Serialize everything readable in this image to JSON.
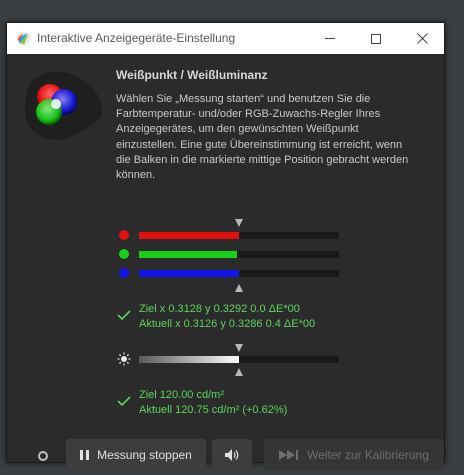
{
  "window": {
    "title": "Interaktive Anzeigegeräte-Einstellung"
  },
  "panel": {
    "heading": "Weißpunkt / Weißluminanz",
    "instructions": "Wählen Sie „Messung starten“ und benutzen Sie die Farbtemperatur- und/oder RGB-Zuwachs-Regler Ihres Anzeigegerätes, um den gewünschten Weißpunkt einzustellen. Eine gute Übereinstimmung ist erreicht, wenn die Balken in die markierte mittige Position gebracht werden können."
  },
  "rgb": {
    "channels": [
      {
        "name": "red",
        "color": "#e01010",
        "level": 0.5
      },
      {
        "name": "green",
        "color": "#17d017",
        "level": 0.49
      },
      {
        "name": "blue",
        "color": "#1414e6",
        "level": 0.5
      }
    ],
    "target_line": "Ziel x 0.3128 y 0.3292 0.0 ΔE*00",
    "actual_line": "Aktuell x 0.3126 y 0.3286 0.4 ΔE*00"
  },
  "luminance": {
    "level": 0.5,
    "target_line": "Ziel 120.00 cd/m²",
    "actual_line": "Aktuell 120.75 cd/m² (+0.62%)"
  },
  "buttons": {
    "stop_label": "Messung stoppen",
    "next_label": "Weiter zur Kalibrierung"
  },
  "icons": {
    "app": "displaycal-icon",
    "pause": "pause-icon",
    "sound": "speaker-icon",
    "next": "skip-forward-icon",
    "status": "status-indicator-icon",
    "sun": "brightness-icon",
    "check": "checkmark-icon"
  },
  "colors": {
    "accent_green": "#5fd35f",
    "background": "#2b2b2b"
  }
}
